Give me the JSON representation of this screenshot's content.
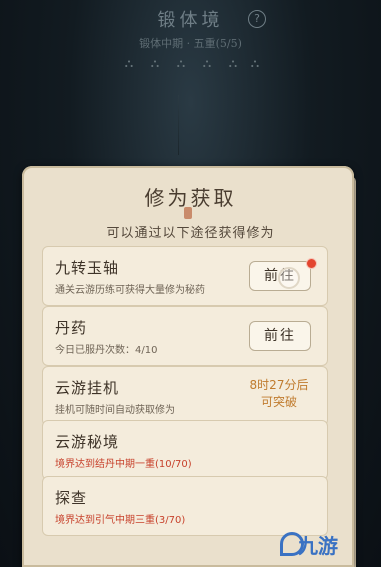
{
  "header": {
    "realm_title": "锻体境",
    "realm_subtitle": "锻体中期 · 五重(5/5)",
    "help_symbol": "?"
  },
  "pips": [
    "⛬",
    "⛬",
    "⛬",
    "⛬",
    "⛬",
    "⛬"
  ],
  "panel": {
    "title": "修为获取",
    "subtitle": "可以通过以下途径获得修为"
  },
  "rows": [
    {
      "title": "九转玉轴",
      "desc": "通关云游历练可获得大量修为秘药",
      "button": "前往",
      "has_notification": true
    },
    {
      "title": "丹药",
      "desc": "今日已服丹次数：4/10",
      "button": "前往"
    },
    {
      "title": "云游挂机",
      "desc": "挂机可随时间自动获取修为",
      "status_time": "8时27分后",
      "status_text": "可突破"
    },
    {
      "title": "云游秘境",
      "desc": "境界达到结丹中期一重(10/70)"
    },
    {
      "title": "探查",
      "desc": "境界达到引气中期三重(3/70)"
    }
  ],
  "colors": {
    "accent_red": "#c7412b",
    "timer_orange": "#c07b2e",
    "panel_bg": "#eae0cc"
  },
  "watermark": "九游"
}
